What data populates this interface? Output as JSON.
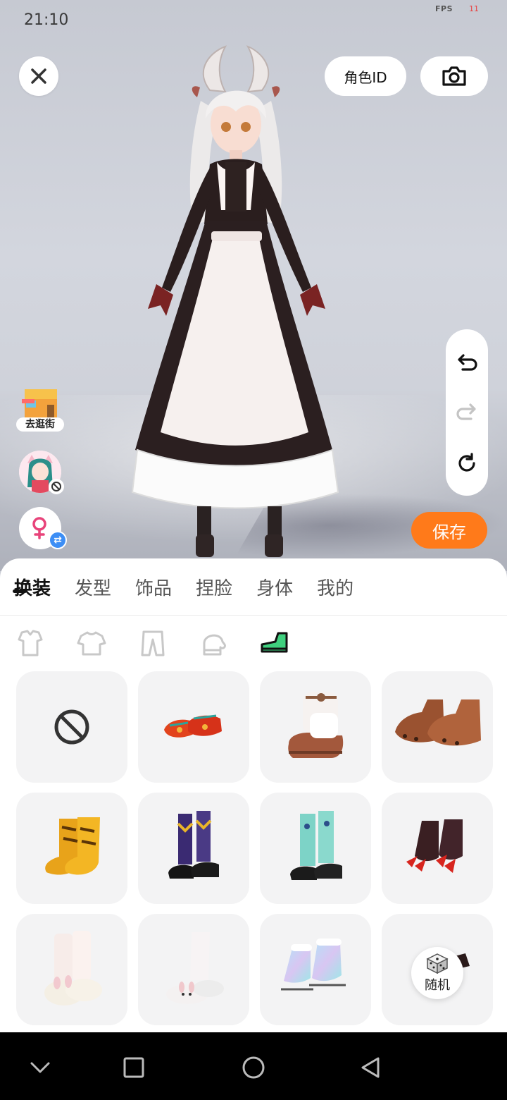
{
  "status_bar": {
    "time": "21:10",
    "fps_label": "FPS",
    "fps_value": "11"
  },
  "header": {
    "close_icon": "close-icon",
    "role_id_label": "角色ID",
    "camera_icon": "camera-icon"
  },
  "history_panel": {
    "undo_icon": "undo-icon",
    "redo_icon": "redo-icon",
    "reset_icon": "reset-icon"
  },
  "side_actions": {
    "shop_label": "去逛街",
    "avatar_icon": "avatar-icon",
    "gender_icon": "female-icon",
    "swap_icon": "swap-icon"
  },
  "save_label": "保存",
  "tabs": [
    {
      "label": "换装",
      "active": true
    },
    {
      "label": "发型"
    },
    {
      "label": "饰品"
    },
    {
      "label": "捏脸"
    },
    {
      "label": "身体"
    },
    {
      "label": "我的"
    }
  ],
  "subcategories": [
    {
      "icon": "full-outfit-icon",
      "active": false
    },
    {
      "icon": "top-icon",
      "active": false
    },
    {
      "icon": "pants-icon",
      "active": false
    },
    {
      "icon": "gloves-icon",
      "active": false
    },
    {
      "icon": "shoes-icon",
      "active": true
    }
  ],
  "items": [
    {
      "icon": "none-icon"
    },
    {
      "icon": "red-flats-icon"
    },
    {
      "icon": "fur-boots-icon"
    },
    {
      "icon": "brown-paw-boots-icon"
    },
    {
      "icon": "tiger-boots-icon"
    },
    {
      "icon": "argyle-socks-shoes-icon"
    },
    {
      "icon": "mint-socks-shoes-icon"
    },
    {
      "icon": "claw-boots-icon"
    },
    {
      "icon": "bunny-slippers-pink-icon"
    },
    {
      "icon": "bunny-slippers-white-icon"
    },
    {
      "icon": "holographic-skates-icon"
    },
    {
      "icon": "dark-shoes-icon"
    }
  ],
  "random_label": "随机",
  "accent": "#ff7a1a",
  "nav": {
    "back_icon": "chevron-down-icon",
    "home_icon": "home-circle-icon",
    "recents_icon": "square-icon",
    "return_icon": "triangle-back-icon"
  }
}
